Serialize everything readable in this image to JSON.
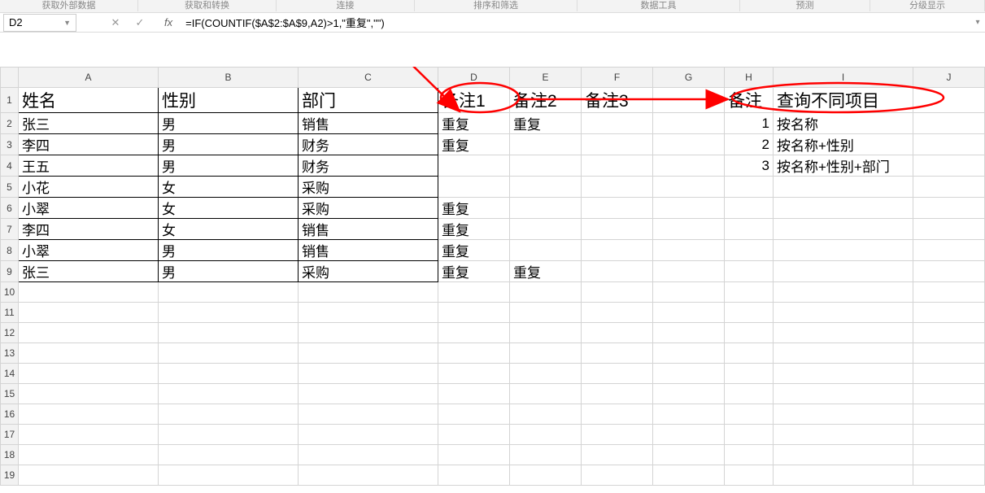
{
  "ribbon": {
    "groups": [
      "获取外部数据",
      "获取和转换",
      "连接",
      "排序和筛选",
      "数据工具",
      "预测",
      "分级显示"
    ]
  },
  "nameBox": {
    "value": "D2"
  },
  "formulaBar": {
    "cancel": "✕",
    "confirm": "✓",
    "fx": "fx",
    "formula": "=IF(COUNTIF($A$2:$A$9,A2)>1,\"重复\",\"\")"
  },
  "columns": [
    "A",
    "B",
    "C",
    "D",
    "E",
    "F",
    "G",
    "H",
    "I",
    "J"
  ],
  "rows": [
    "1",
    "2",
    "3",
    "4",
    "5",
    "6",
    "7",
    "8",
    "9",
    "10",
    "11",
    "12",
    "13",
    "14",
    "15",
    "16",
    "17",
    "18",
    "19"
  ],
  "headerRow": {
    "A": "姓名",
    "B": "性别",
    "C": "部门",
    "D": "备注1",
    "E": "备注2",
    "F": "备注3",
    "H": "备注",
    "I": "查询不同项目"
  },
  "data": [
    {
      "A": "张三",
      "B": "男",
      "C": "销售",
      "D": "重复",
      "E": "重复",
      "H": "1",
      "I": "按名称"
    },
    {
      "A": "李四",
      "B": "男",
      "C": "财务",
      "D": "重复",
      "H": "2",
      "I": "按名称+性别"
    },
    {
      "A": "王五",
      "B": "男",
      "C": "财务",
      "H": "3",
      "I": "按名称+性别+部门"
    },
    {
      "A": "小花",
      "B": "女",
      "C": "采购"
    },
    {
      "A": "小翠",
      "B": "女",
      "C": "采购",
      "D": "重复"
    },
    {
      "A": "李四",
      "B": "女",
      "C": "销售",
      "D": "重复"
    },
    {
      "A": "小翠",
      "B": "男",
      "C": "销售",
      "D": "重复"
    },
    {
      "A": "张三",
      "B": "男",
      "C": "采购",
      "D": "重复",
      "E": "重复"
    }
  ],
  "chart_data": {
    "type": "table",
    "title": "",
    "columns": [
      "姓名",
      "性别",
      "部门",
      "备注1",
      "备注2",
      "备注3",
      "备注",
      "查询不同项目"
    ],
    "rows": [
      [
        "张三",
        "男",
        "销售",
        "重复",
        "重复",
        "",
        "1",
        "按名称"
      ],
      [
        "李四",
        "男",
        "财务",
        "重复",
        "",
        "",
        "2",
        "按名称+性别"
      ],
      [
        "王五",
        "男",
        "财务",
        "",
        "",
        "",
        "3",
        "按名称+性别+部门"
      ],
      [
        "小花",
        "女",
        "采购",
        "",
        "",
        "",
        "",
        ""
      ],
      [
        "小翠",
        "女",
        "采购",
        "重复",
        "",
        "",
        "",
        ""
      ],
      [
        "李四",
        "女",
        "销售",
        "重复",
        "",
        "",
        "",
        ""
      ],
      [
        "小翠",
        "男",
        "销售",
        "重复",
        "",
        "",
        "",
        ""
      ],
      [
        "张三",
        "男",
        "采购",
        "重复",
        "重复",
        "",
        "",
        ""
      ]
    ]
  }
}
